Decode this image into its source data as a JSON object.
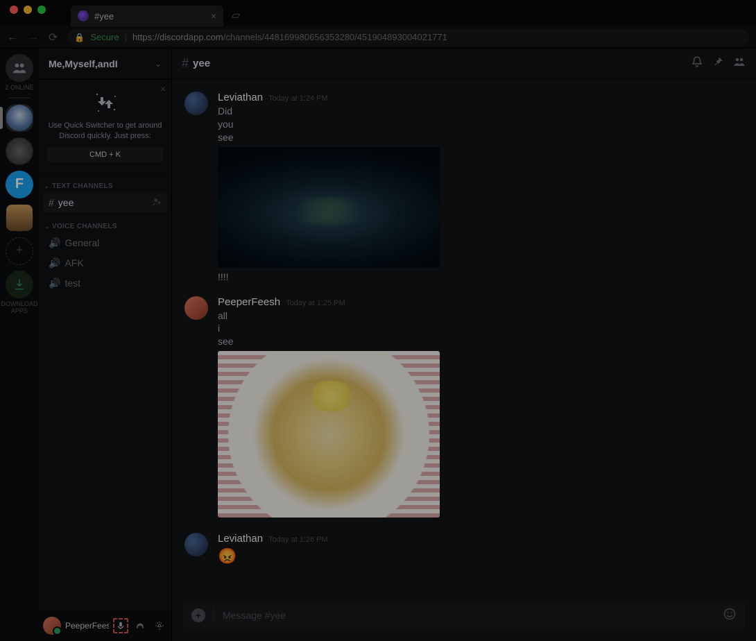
{
  "browser": {
    "tab_title": "#yee",
    "secure_label": "Secure",
    "url_host": "https://discordapp.com",
    "url_path": "/channels/448169980656353280/451904893004021771"
  },
  "guilds": {
    "online_label": "2 ONLINE",
    "server3_letter": "F",
    "download_label": "DOWNLOAD APPS"
  },
  "server": {
    "name": "Me,Myself,andI"
  },
  "quickswitch": {
    "text": "Use Quick Switcher to get around Discord quickly. Just press:",
    "key": "CMD + K"
  },
  "categories": {
    "text_label": "TEXT CHANNELS",
    "voice_label": "VOICE CHANNELS"
  },
  "channels": {
    "text": [
      {
        "name": "yee",
        "selected": true
      }
    ],
    "voice": [
      {
        "name": "General"
      },
      {
        "name": "AFK"
      },
      {
        "name": "test"
      }
    ]
  },
  "user_panel": {
    "username": "PeeperFeesh"
  },
  "chat": {
    "channel_name": "yee",
    "input_placeholder": "Message #yee"
  },
  "messages": [
    {
      "author": "Leviathan",
      "time": "Today at 1:24 PM",
      "lines": [
        "Did",
        "you",
        "see"
      ],
      "attachment": "octopus",
      "post_lines": [
        "!!!!"
      ]
    },
    {
      "author": "PeeperFeesh",
      "time": "Today at 1:25 PM",
      "lines": [
        "all",
        "i",
        "see"
      ],
      "attachment": "food",
      "post_lines": []
    },
    {
      "author": "Leviathan",
      "time": "Today at 1:26 PM",
      "lines": [],
      "emoji": "😡",
      "post_lines": []
    }
  ]
}
